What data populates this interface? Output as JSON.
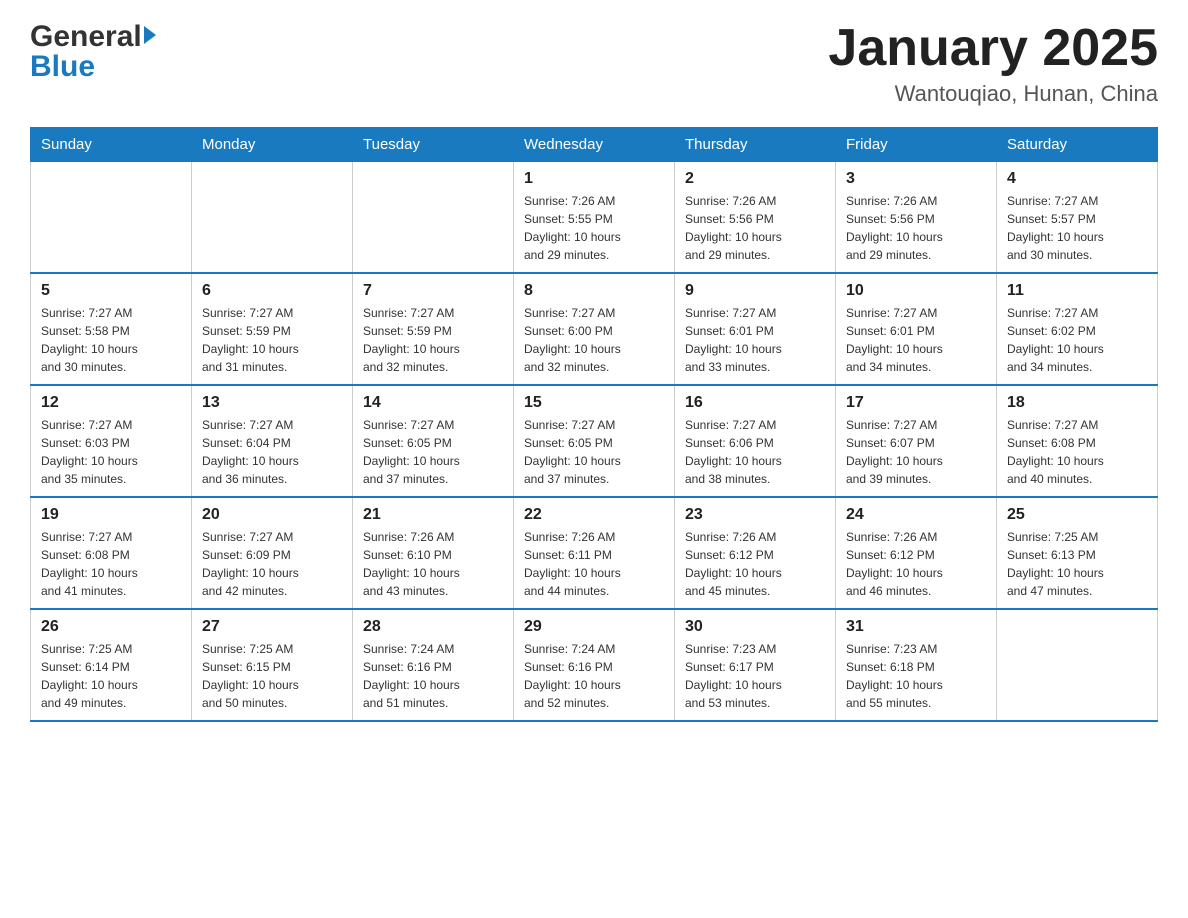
{
  "header": {
    "logo_general": "General",
    "logo_blue": "Blue",
    "month_title": "January 2025",
    "location": "Wantouqiao, Hunan, China"
  },
  "days_of_week": [
    "Sunday",
    "Monday",
    "Tuesday",
    "Wednesday",
    "Thursday",
    "Friday",
    "Saturday"
  ],
  "weeks": [
    [
      {
        "day": "",
        "info": ""
      },
      {
        "day": "",
        "info": ""
      },
      {
        "day": "",
        "info": ""
      },
      {
        "day": "1",
        "info": "Sunrise: 7:26 AM\nSunset: 5:55 PM\nDaylight: 10 hours\nand 29 minutes."
      },
      {
        "day": "2",
        "info": "Sunrise: 7:26 AM\nSunset: 5:56 PM\nDaylight: 10 hours\nand 29 minutes."
      },
      {
        "day": "3",
        "info": "Sunrise: 7:26 AM\nSunset: 5:56 PM\nDaylight: 10 hours\nand 29 minutes."
      },
      {
        "day": "4",
        "info": "Sunrise: 7:27 AM\nSunset: 5:57 PM\nDaylight: 10 hours\nand 30 minutes."
      }
    ],
    [
      {
        "day": "5",
        "info": "Sunrise: 7:27 AM\nSunset: 5:58 PM\nDaylight: 10 hours\nand 30 minutes."
      },
      {
        "day": "6",
        "info": "Sunrise: 7:27 AM\nSunset: 5:59 PM\nDaylight: 10 hours\nand 31 minutes."
      },
      {
        "day": "7",
        "info": "Sunrise: 7:27 AM\nSunset: 5:59 PM\nDaylight: 10 hours\nand 32 minutes."
      },
      {
        "day": "8",
        "info": "Sunrise: 7:27 AM\nSunset: 6:00 PM\nDaylight: 10 hours\nand 32 minutes."
      },
      {
        "day": "9",
        "info": "Sunrise: 7:27 AM\nSunset: 6:01 PM\nDaylight: 10 hours\nand 33 minutes."
      },
      {
        "day": "10",
        "info": "Sunrise: 7:27 AM\nSunset: 6:01 PM\nDaylight: 10 hours\nand 34 minutes."
      },
      {
        "day": "11",
        "info": "Sunrise: 7:27 AM\nSunset: 6:02 PM\nDaylight: 10 hours\nand 34 minutes."
      }
    ],
    [
      {
        "day": "12",
        "info": "Sunrise: 7:27 AM\nSunset: 6:03 PM\nDaylight: 10 hours\nand 35 minutes."
      },
      {
        "day": "13",
        "info": "Sunrise: 7:27 AM\nSunset: 6:04 PM\nDaylight: 10 hours\nand 36 minutes."
      },
      {
        "day": "14",
        "info": "Sunrise: 7:27 AM\nSunset: 6:05 PM\nDaylight: 10 hours\nand 37 minutes."
      },
      {
        "day": "15",
        "info": "Sunrise: 7:27 AM\nSunset: 6:05 PM\nDaylight: 10 hours\nand 37 minutes."
      },
      {
        "day": "16",
        "info": "Sunrise: 7:27 AM\nSunset: 6:06 PM\nDaylight: 10 hours\nand 38 minutes."
      },
      {
        "day": "17",
        "info": "Sunrise: 7:27 AM\nSunset: 6:07 PM\nDaylight: 10 hours\nand 39 minutes."
      },
      {
        "day": "18",
        "info": "Sunrise: 7:27 AM\nSunset: 6:08 PM\nDaylight: 10 hours\nand 40 minutes."
      }
    ],
    [
      {
        "day": "19",
        "info": "Sunrise: 7:27 AM\nSunset: 6:08 PM\nDaylight: 10 hours\nand 41 minutes."
      },
      {
        "day": "20",
        "info": "Sunrise: 7:27 AM\nSunset: 6:09 PM\nDaylight: 10 hours\nand 42 minutes."
      },
      {
        "day": "21",
        "info": "Sunrise: 7:26 AM\nSunset: 6:10 PM\nDaylight: 10 hours\nand 43 minutes."
      },
      {
        "day": "22",
        "info": "Sunrise: 7:26 AM\nSunset: 6:11 PM\nDaylight: 10 hours\nand 44 minutes."
      },
      {
        "day": "23",
        "info": "Sunrise: 7:26 AM\nSunset: 6:12 PM\nDaylight: 10 hours\nand 45 minutes."
      },
      {
        "day": "24",
        "info": "Sunrise: 7:26 AM\nSunset: 6:12 PM\nDaylight: 10 hours\nand 46 minutes."
      },
      {
        "day": "25",
        "info": "Sunrise: 7:25 AM\nSunset: 6:13 PM\nDaylight: 10 hours\nand 47 minutes."
      }
    ],
    [
      {
        "day": "26",
        "info": "Sunrise: 7:25 AM\nSunset: 6:14 PM\nDaylight: 10 hours\nand 49 minutes."
      },
      {
        "day": "27",
        "info": "Sunrise: 7:25 AM\nSunset: 6:15 PM\nDaylight: 10 hours\nand 50 minutes."
      },
      {
        "day": "28",
        "info": "Sunrise: 7:24 AM\nSunset: 6:16 PM\nDaylight: 10 hours\nand 51 minutes."
      },
      {
        "day": "29",
        "info": "Sunrise: 7:24 AM\nSunset: 6:16 PM\nDaylight: 10 hours\nand 52 minutes."
      },
      {
        "day": "30",
        "info": "Sunrise: 7:23 AM\nSunset: 6:17 PM\nDaylight: 10 hours\nand 53 minutes."
      },
      {
        "day": "31",
        "info": "Sunrise: 7:23 AM\nSunset: 6:18 PM\nDaylight: 10 hours\nand 55 minutes."
      },
      {
        "day": "",
        "info": ""
      }
    ]
  ]
}
